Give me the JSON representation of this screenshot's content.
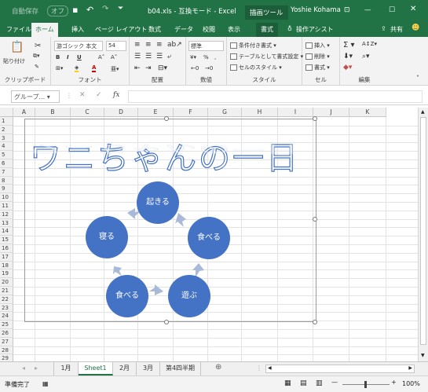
{
  "titlebar": {
    "autosave": "自動保存",
    "autosave_state": "オフ",
    "filename": "b04.xls - 互換モード - Excel",
    "context_tool": "描画ツール",
    "user": "Yoshie Kohama"
  },
  "tabs": [
    "ファイル",
    "ホーム",
    "挿入",
    "ページ レイアウト",
    "数式",
    "データ",
    "校閲",
    "表示",
    "書式"
  ],
  "tell_me": "操作アシスト",
  "share": "共有",
  "ribbon": {
    "clipboard": {
      "label": "クリップボード",
      "paste": "貼り付け"
    },
    "font": {
      "label": "フォント",
      "name": "游ゴシック 本文",
      "size": "54"
    },
    "alignment": {
      "label": "配置"
    },
    "number": {
      "label": "数値",
      "format": "標準",
      "pct": "%"
    },
    "styles": {
      "label": "スタイル",
      "cond": "条件付き書式",
      "table": "テーブルとして書式設定",
      "cell": "セルのスタイル"
    },
    "cells": {
      "label": "セル",
      "insert": "挿入",
      "delete": "削除",
      "format": "書式"
    },
    "editing": {
      "label": "編集"
    }
  },
  "formula_bar": {
    "name_box": "グループ..."
  },
  "columns": [
    "A",
    "B",
    "C",
    "D",
    "E",
    "F",
    "G",
    "H",
    "I",
    "J",
    "K"
  ],
  "rows": [
    "1",
    "2",
    "3",
    "4",
    "5",
    "6",
    "7",
    "8",
    "9",
    "10",
    "11",
    "12",
    "13",
    "14",
    "15",
    "16",
    "17",
    "18",
    "19",
    "20",
    "21",
    "22",
    "23",
    "24",
    "25",
    "26",
    "27",
    "28",
    "29"
  ],
  "wordart": "ワニちゃんの一日",
  "cycle": [
    "起きる",
    "食べる",
    "遊ぶ",
    "食べる",
    "寝る"
  ],
  "sheets": [
    "1月",
    "Sheet1",
    "2月",
    "3月",
    "第4四半期"
  ],
  "active_sheet": "Sheet1",
  "status": {
    "ready": "準備完了",
    "zoom": "100%"
  },
  "colors": {
    "accent": "#217346",
    "circle": "#4472c4",
    "arrow": "#a9b9d8"
  }
}
